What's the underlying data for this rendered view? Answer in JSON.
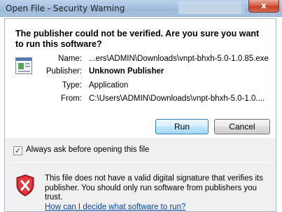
{
  "window": {
    "title": "Open File - Security Warning",
    "close_glyph": "x"
  },
  "question": "The publisher could not be verified.  Are you sure you want to run this software?",
  "details": {
    "name_label": "Name:",
    "name_value": "...ers\\ADMIN\\Downloads\\vnpt-bhxh-5.0-1.0.85.exe",
    "publisher_label": "Publisher:",
    "publisher_value": "Unknown Publisher",
    "type_label": "Type:",
    "type_value": "Application",
    "from_label": "From:",
    "from_value": "C:\\Users\\ADMIN\\Downloads\\vnpt-bhxh-5.0-1.0...."
  },
  "buttons": {
    "run": "Run",
    "cancel": "Cancel"
  },
  "checkbox": {
    "label": "Always ask before opening this file",
    "checked": true,
    "mark": "✓"
  },
  "warning": {
    "text": "This file does not have a valid digital signature that verifies its publisher.  You should only run software from publishers you trust.",
    "link": "How can I decide what software to run?"
  }
}
